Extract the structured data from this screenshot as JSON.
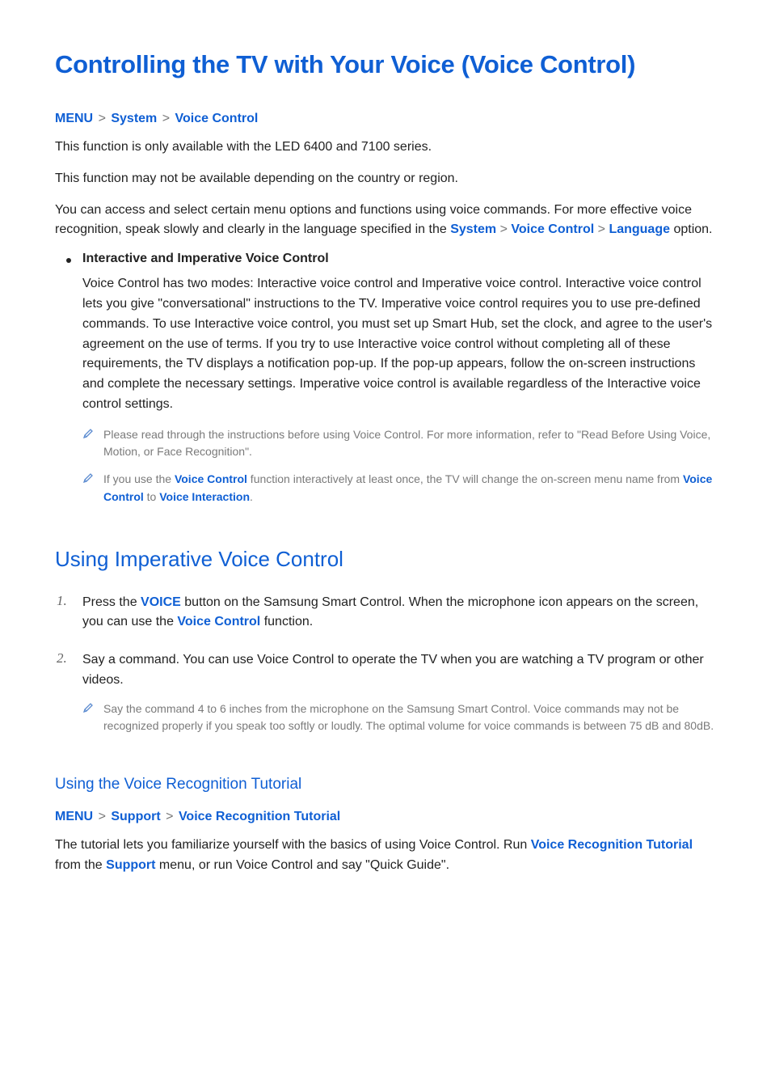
{
  "title": "Controlling the TV with Your Voice (Voice Control)",
  "bc1": {
    "a": "MENU",
    "b": "System",
    "c": "Voice Control"
  },
  "p1": "This function is only available with the LED 6400 and 7100 series.",
  "p2": "This function may not be available depending on the country or region.",
  "p3a": "You can access and select certain menu options and functions using voice commands. For more effective voice recognition, speak slowly and clearly in the language specified in the ",
  "p3b": "System",
  "p3c": "Voice Control",
  "p3d": "Language",
  "p3e": " option.",
  "bullet1_title": "Interactive and Imperative Voice Control",
  "bullet1_body": "Voice Control has two modes: Interactive voice control and Imperative voice control. Interactive voice control lets you give \"conversational\" instructions to the TV. Imperative voice control requires you to use pre-defined commands. To use Interactive voice control, you must set up Smart Hub, set the clock, and agree to the user's agreement on the use of terms. If you try to use Interactive voice control without completing all of these requirements, the TV displays a notification pop-up. If the pop-up appears, follow the on-screen instructions and complete the necessary settings. Imperative voice control is available regardless of the Interactive voice control settings.",
  "note1": "Please read through the instructions before using Voice Control. For more information, refer to \"Read Before Using Voice, Motion, or Face Recognition\".",
  "note2a": "If you use the ",
  "note2b": "Voice Control",
  "note2c": " function interactively at least once, the TV will change the on-screen menu name from ",
  "note2d": "Voice Control",
  "note2e": " to ",
  "note2f": "Voice Interaction",
  "note2g": ".",
  "h2": "Using Imperative Voice Control",
  "step1a": "Press the ",
  "step1b": "VOICE",
  "step1c": " button on the Samsung Smart Control. When the microphone icon appears on the screen, you can use the ",
  "step1d": "Voice Control",
  "step1e": " function.",
  "step2": "Say a command. You can use Voice Control to operate the TV when you are watching a TV program or other videos.",
  "step2_note": "Say the command 4 to 6 inches from the microphone on the Samsung Smart Control. Voice commands may not be recognized properly if you speak too softly or loudly. The optimal volume for voice commands is between 75 dB and 80dB.",
  "h3": "Using the Voice Recognition Tutorial",
  "bc2": {
    "a": "MENU",
    "b": "Support",
    "c": "Voice Recognition Tutorial"
  },
  "tut_a": "The tutorial lets you familiarize yourself with the basics of using Voice Control. Run ",
  "tut_b": "Voice Recognition Tutorial",
  "tut_c": " from the ",
  "tut_d": "Support",
  "tut_e": " menu, or run Voice Control and say \"Quick Guide\"."
}
